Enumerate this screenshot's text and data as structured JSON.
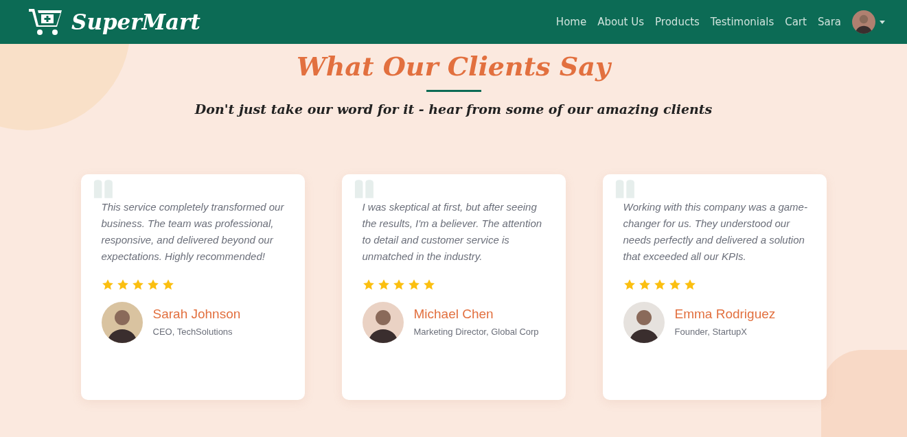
{
  "navbar": {
    "brand": "SuperMart",
    "links": [
      "Home",
      "About Us",
      "Products",
      "Testimonials",
      "Cart"
    ],
    "user": "Sara"
  },
  "section": {
    "title": "What Our Clients Say",
    "subtitle": "Don't just take our word for it - hear from some of our amazing clients"
  },
  "testimonials": [
    {
      "quote": "This service completely transformed our business. The team was professional, responsive, and delivered beyond our expectations. Highly recommended!",
      "stars": 5,
      "name": "Sarah Johnson",
      "role": "CEO, TechSolutions"
    },
    {
      "quote": "I was skeptical at first, but after seeing the results, I'm a believer. The attention to detail and customer service is unmatched in the industry.",
      "stars": 5,
      "name": "Michael Chen",
      "role": "Marketing Director, Global Corp"
    },
    {
      "quote": "Working with this company was a game-changer for us. They understood our needs perfectly and delivered a solution that exceeded all our KPIs.",
      "stars": 5,
      "name": "Emma Rodriguez",
      "role": "Founder, StartupX"
    }
  ]
}
